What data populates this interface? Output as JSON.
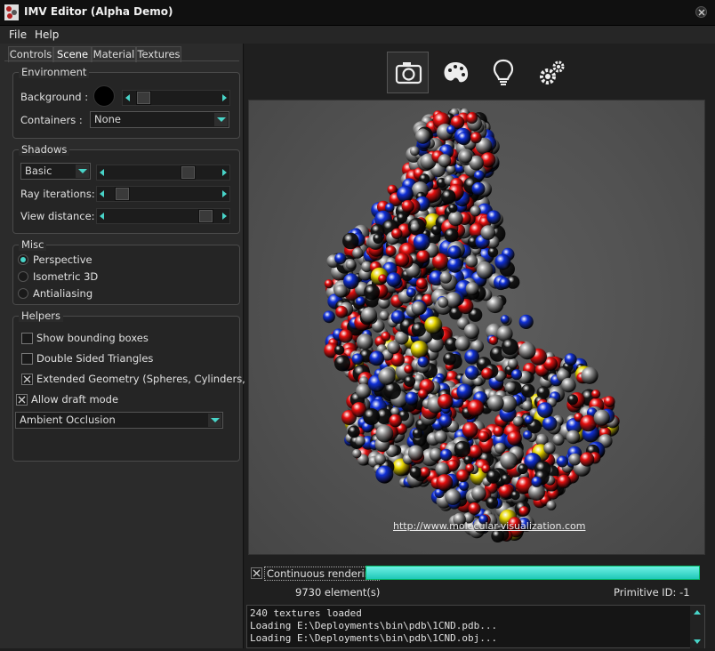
{
  "window": {
    "title": "IMV Editor (Alpha Demo)"
  },
  "menu": [
    "File",
    "Help"
  ],
  "tabs": [
    "Controls",
    "Scene",
    "Material",
    "Textures"
  ],
  "environment": {
    "title": "Environment",
    "background_label": "Background :",
    "background_color": "#000000",
    "containers_label": "Containers :",
    "containers_value": "None"
  },
  "shadows": {
    "title": "Shadows",
    "mode_value": "Basic",
    "ray_label": "Ray iterations:",
    "view_label": "View distance:"
  },
  "misc": {
    "title": "Misc",
    "options": [
      "Perspective",
      "Isometric 3D",
      "Antialiasing"
    ],
    "selected": "Perspective"
  },
  "helpers": {
    "title": "Helpers",
    "checks": [
      {
        "label": "Show bounding boxes",
        "checked": false
      },
      {
        "label": "Double Sided Triangles",
        "checked": false
      },
      {
        "label": "Extended Geometry (Spheres, Cylinders, etc.)",
        "checked": true
      }
    ]
  },
  "draft_mode": {
    "label": "Allow draft mode",
    "checked": true
  },
  "render_mode": {
    "value": "Ambient Occlusion"
  },
  "toolbar": {
    "icons": [
      "camera-icon",
      "palette-icon",
      "lightbulb-icon",
      "gears-icon"
    ],
    "active": "camera-icon"
  },
  "viewport": {
    "credit": "http://www.molecular-visualization.com"
  },
  "status": {
    "continuous_label": "Continuous rendering",
    "continuous_checked": true,
    "progress_percent": 100,
    "elements": "9730 element(s)",
    "primitive_id": "Primitive ID: -1"
  },
  "console": {
    "lines": [
      "240 textures loaded",
      "Loading E:\\Deployments\\bin\\pdb\\1CND.pdb...",
      "Loading E:\\Deployments\\bin\\pdb\\1CND.obj..."
    ]
  },
  "colors": {
    "accent": "#48d4c8",
    "progress": "#2fdccc",
    "atom_red": "#e81010",
    "atom_blue": "#1030d8",
    "atom_gray": "#9a9a9a",
    "atom_black": "#161616",
    "atom_yellow": "#e8d800"
  }
}
